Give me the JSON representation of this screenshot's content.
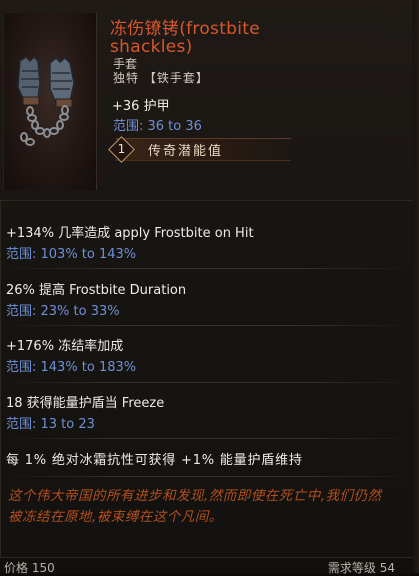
{
  "item": {
    "name": "冻伤镣铐(frostbite shackles)",
    "type": "手套",
    "rarity_line": "独特 【铁手套】",
    "armor": "+36 护甲",
    "armor_range": "范围: 36 to 36",
    "legendary_potential_value": "1",
    "legendary_potential_label": "传奇潜能值",
    "icon": "chained-gauntlet-icon"
  },
  "affixes": [
    {
      "text": "+134% 几率造成 apply Frostbite on Hit",
      "range": "范围: 103% to 143%"
    },
    {
      "text": "26% 提高 Frostbite Duration",
      "range": "范围: 23% to 33%"
    },
    {
      "text": "+176% 冻结率加成",
      "range": "范围: 143% to 183%"
    },
    {
      "text": "18 获得能量护盾当 Freeze",
      "range": "范围: 13 to 23"
    }
  ],
  "unique_effect": "每 1% 绝对冰霜抗性可获得 +1% 能量护盾维持",
  "lore": "这个伟大帝国的所有进步和发现,然而即使在死亡中,我们仍然被冻结在原地,被束缚在这个凡间。",
  "footer": {
    "left": "价格 150",
    "right": "需求等级 54"
  },
  "colors": {
    "unique_name": "#d9572a",
    "range_text": "#6f8fd6",
    "lore_text": "#b24f1e"
  }
}
